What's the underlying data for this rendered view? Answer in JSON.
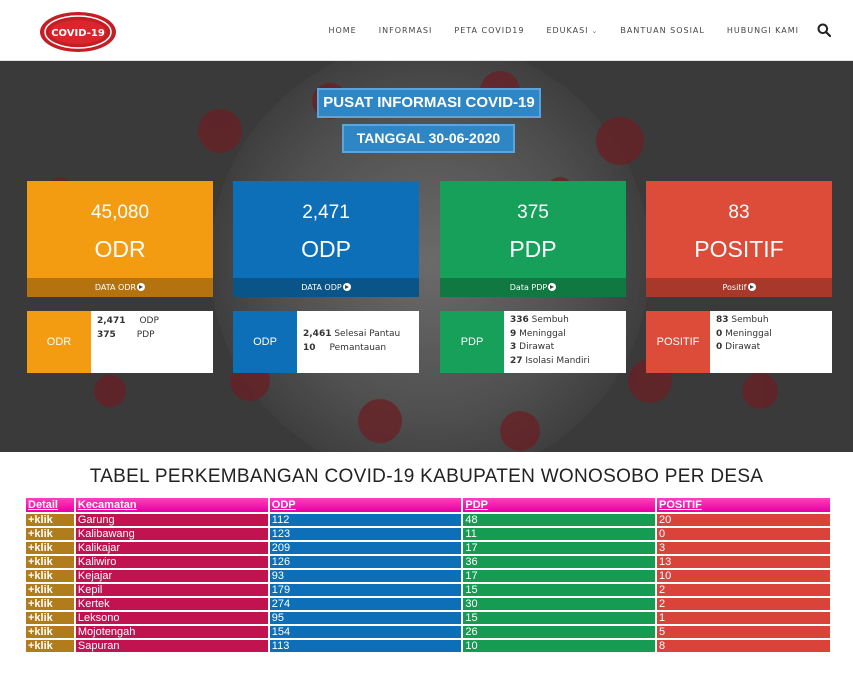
{
  "nav": {
    "logo_text": "COVID-19",
    "items": [
      "HOME",
      "INFORMASI",
      "PETA COVID19",
      "EDUKASI",
      "BANTUAN SOSIAL",
      "HUBUNGI KAMI"
    ]
  },
  "hero": {
    "title": "PUSAT INFORMASI COVID-19",
    "date": "TANGGAL 30-06-2020",
    "stats": [
      {
        "value": "45,080",
        "label": "ODR",
        "link": "DATA ODR",
        "color": "#f39c12",
        "foot_color": "#b4730e"
      },
      {
        "value": "2,471",
        "label": "ODP",
        "link": "DATA ODP",
        "color": "#0c6fb8",
        "foot_color": "#095489"
      },
      {
        "value": "375",
        "label": "PDP",
        "link": "Data PDP",
        "color": "#16a05a",
        "foot_color": "#107841"
      },
      {
        "value": "83",
        "label": "POSITIF",
        "link": "Positif",
        "color": "#dd4b39",
        "foot_color": "#a8382a"
      }
    ],
    "details": [
      {
        "tag": "ODR",
        "lines": [
          [
            "2,471",
            "ODP"
          ],
          [
            "375",
            "PDP"
          ]
        ]
      },
      {
        "tag": "ODP",
        "lines": [
          [
            "2,461",
            "Selesai Pantau"
          ],
          [
            "10",
            "Pemantauan"
          ]
        ]
      },
      {
        "tag": "PDP",
        "lines": [
          [
            "336",
            "Sembuh"
          ],
          [
            "9",
            "Meninggal"
          ],
          [
            "3",
            "Dirawat"
          ],
          [
            "27",
            "Isolasi Mandiri"
          ]
        ]
      },
      {
        "tag": "POSITIF",
        "lines": [
          [
            "83",
            "Sembuh"
          ],
          [
            "0",
            "Meninggal"
          ],
          [
            "0",
            "Dirawat"
          ]
        ]
      }
    ]
  },
  "table": {
    "title": "TABEL PERKEMBANGAN COVID-19 KABUPATEN WONOSOBO PER DESA",
    "headers": [
      "Detail",
      "Kecamatan",
      "ODP",
      "PDP",
      "POSITIF"
    ],
    "rows": [
      [
        "+klik",
        "Garung",
        "112",
        "48",
        "20"
      ],
      [
        "+klik",
        "Kalibawang",
        "123",
        "11",
        "0"
      ],
      [
        "+klik",
        "Kalikajar",
        "209",
        "17",
        "3"
      ],
      [
        "+klik",
        "Kaliwiro",
        "126",
        "36",
        "13"
      ],
      [
        "+klik",
        "Kejajar",
        "93",
        "17",
        "10"
      ],
      [
        "+klik",
        "Kepil",
        "179",
        "15",
        "2"
      ],
      [
        "+klik",
        "Kertek",
        "274",
        "30",
        "2"
      ],
      [
        "+klik",
        "Leksono",
        "95",
        "15",
        "1"
      ],
      [
        "+klik",
        "Mojotengah",
        "154",
        "26",
        "5"
      ],
      [
        "+klik",
        "Sapuran",
        "113",
        "10",
        "8"
      ]
    ]
  }
}
